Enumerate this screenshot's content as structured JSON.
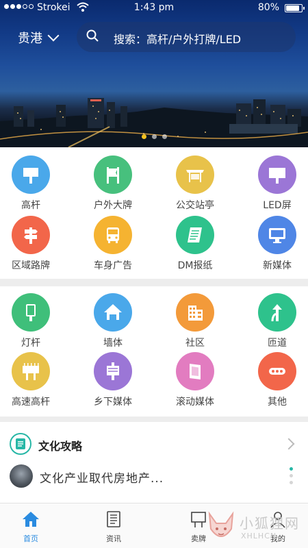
{
  "status": {
    "carrier": "Strokei",
    "time": "1:43 pm",
    "battery": "80%"
  },
  "header": {
    "city": "贵港",
    "search_placeholder": "搜索：高杆/户外打牌/LED"
  },
  "categories_1": [
    {
      "label": "高杆",
      "color": "#4aa8ea",
      "icon": "billboard-icon"
    },
    {
      "label": "户外大牌",
      "color": "#47c07d",
      "icon": "outdoor-sign-icon"
    },
    {
      "label": "公交站亭",
      "color": "#e8c24a",
      "icon": "bus-shelter-icon"
    },
    {
      "label": "LED屏",
      "color": "#9b76d6",
      "icon": "led-screen-icon"
    },
    {
      "label": "区域路牌",
      "color": "#f2664a",
      "icon": "road-sign-icon"
    },
    {
      "label": "车身广告",
      "color": "#f5b331",
      "icon": "bus-icon"
    },
    {
      "label": "DM报纸",
      "color": "#2ec28c",
      "icon": "newspaper-icon"
    },
    {
      "label": "新媒体",
      "color": "#4f86e6",
      "icon": "monitor-icon"
    }
  ],
  "categories_2": [
    {
      "label": "灯杆",
      "color": "#3fbf7a",
      "icon": "lamp-pole-icon"
    },
    {
      "label": "墙体",
      "color": "#4aa8ea",
      "icon": "house-icon"
    },
    {
      "label": "社区",
      "color": "#f39a3a",
      "icon": "building-icon"
    },
    {
      "label": "匝道",
      "color": "#2ec28c",
      "icon": "ramp-arrow-icon"
    },
    {
      "label": "高速高杆",
      "color": "#e8c24a",
      "icon": "highway-billboard-icon"
    },
    {
      "label": "乡下媒体",
      "color": "#9b76d6",
      "icon": "rural-media-icon"
    },
    {
      "label": "滚动媒体",
      "color": "#e27cc0",
      "icon": "scroll-media-icon"
    },
    {
      "label": "其他",
      "color": "#f2664a",
      "icon": "more-dots-icon"
    }
  ],
  "article": {
    "section_title": "文化攻略",
    "headline": "文化产业取代房地产..."
  },
  "tabs": [
    {
      "label": "首页",
      "icon": "home-icon",
      "active": true
    },
    {
      "label": "资讯",
      "icon": "news-icon",
      "active": false
    },
    {
      "label": "卖牌",
      "icon": "sell-sign-icon",
      "active": false
    },
    {
      "label": "我的",
      "icon": "profile-icon",
      "active": false
    }
  ],
  "watermark": {
    "text": "小狐狸网",
    "sub": "XHLHCN"
  },
  "colors": {
    "accent": "#2a8be0",
    "teal": "#27b7a6",
    "pager_active": "#f5c220"
  }
}
